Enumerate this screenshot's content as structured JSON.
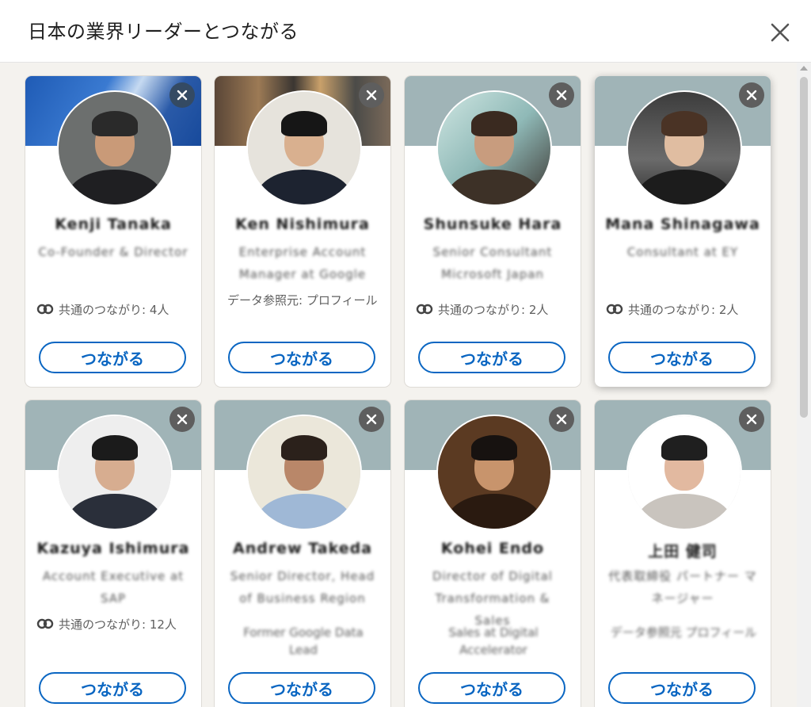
{
  "dialog": {
    "title": "日本の業界リーダーとつながる"
  },
  "connect_label": "つながる",
  "colors": {
    "accent": "#0a66c2",
    "banner": "#a0b4b7",
    "dismiss": "#5e5e5e"
  },
  "cards": [
    {
      "name": "Kenji Tanaka",
      "headline": "Co-Founder & Director",
      "mutual": "共通のつながり: 4人",
      "source": ""
    },
    {
      "name": "Ken Nishimura",
      "headline": "Enterprise Account Manager at Google",
      "mutual": "",
      "source": "データ参照元: プロフィール"
    },
    {
      "name": "Shunsuke Hara",
      "headline": "Senior Consultant Microsoft Japan",
      "mutual": "共通のつながり: 2人",
      "source": ""
    },
    {
      "name": "Mana Shinagawa",
      "headline": "Consultant at EY",
      "mutual": "共通のつながり: 2人",
      "source": ""
    },
    {
      "name": "Kazuya Ishimura",
      "headline": "Account Executive at SAP",
      "mutual": "共通のつながり: 12人",
      "source": ""
    },
    {
      "name": "Andrew Takeda",
      "headline": "Senior Director, Head of Business Region",
      "mutual": "",
      "source": "Former Google Data Lead"
    },
    {
      "name": "Kohei Endo",
      "headline": "Director of Digital Transformation & Sales",
      "mutual": "",
      "source": "Sales at Digital Accelerator"
    },
    {
      "name": "上田 健司",
      "headline": "代表取締役 パートナー マネージャー",
      "mutual": "",
      "source": "データ参照元 プロフィール"
    }
  ]
}
